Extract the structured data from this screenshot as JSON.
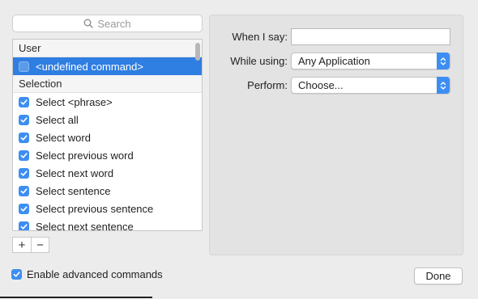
{
  "search": {
    "placeholder": "Search"
  },
  "list": {
    "groups": [
      {
        "header": "User",
        "items": [
          {
            "label": "<undefined command>",
            "checked": false,
            "selected": true
          }
        ]
      },
      {
        "header": "Selection",
        "items": [
          {
            "label": "Select <phrase>",
            "checked": true
          },
          {
            "label": "Select all",
            "checked": true
          },
          {
            "label": "Select word",
            "checked": true
          },
          {
            "label": "Select previous word",
            "checked": true
          },
          {
            "label": "Select next word",
            "checked": true
          },
          {
            "label": "Select sentence",
            "checked": true
          },
          {
            "label": "Select previous sentence",
            "checked": true
          },
          {
            "label": "Select next sentence",
            "checked": true
          }
        ]
      }
    ]
  },
  "toolbar": {
    "add_label": "+",
    "remove_label": "−"
  },
  "detail": {
    "when_label": "When I say:",
    "when_value": "",
    "using_label": "While using:",
    "using_value": "Any Application",
    "perform_label": "Perform:",
    "perform_value": "Choose..."
  },
  "footer": {
    "advanced_label": "Enable advanced commands",
    "advanced_checked": true,
    "done_label": "Done"
  },
  "colors": {
    "accent": "#3d8ef2",
    "selection": "#2f7ee2"
  },
  "icons": {
    "search": "magnifier-icon",
    "checkbox": "checkmark-icon",
    "popup": "up-down-arrows-icon"
  }
}
